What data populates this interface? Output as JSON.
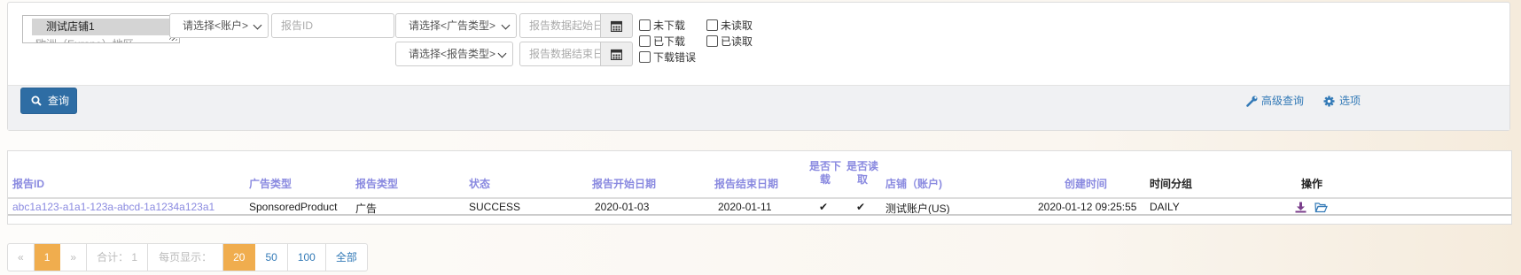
{
  "filters": {
    "store_select": {
      "selected": "测试店铺1",
      "second_option": "欧洲（Europe）地区"
    },
    "account_select": "请选择<账户>",
    "report_id_placeholder": "报告ID",
    "ad_type_select": "请选择<广告类型>",
    "report_type_select": "请选择<报告类型>",
    "start_date_placeholder": "报告数据起始日期",
    "end_date_placeholder": "报告数据结束日期",
    "checkboxes": {
      "not_downloaded": "未下载",
      "downloaded": "已下载",
      "download_error": "下载错误",
      "unread": "未读取",
      "read": "已读取"
    },
    "query_button": "查询",
    "advanced_query": "高级查询",
    "options": "选项"
  },
  "table": {
    "headers": {
      "report_id": "报告ID",
      "ad_type": "广告类型",
      "report_type": "报告类型",
      "status": "状态",
      "start_date": "报告开始日期",
      "end_date": "报告结束日期",
      "is_downloaded_1": "是否下",
      "is_downloaded_2": "载",
      "is_read_1": "是否读",
      "is_read_2": "取",
      "store_account": "店铺（账户)",
      "created_time": "创建时间",
      "time_group": "时间分组",
      "actions": "操作"
    },
    "rows": [
      {
        "report_id": "abc1a123-a1a1-123a-abcd-1a1234a123a1",
        "ad_type": "SponsoredProduct",
        "report_type": "广告",
        "status": "SUCCESS",
        "start_date": "2020-01-03",
        "end_date": "2020-01-11",
        "is_downloaded": "✔",
        "is_read": "✔",
        "store_account": "测试账户(US)",
        "created_time": "2020-01-12 09:25:55",
        "time_group": "DAILY"
      }
    ]
  },
  "pagination": {
    "prev": "«",
    "current_page": "1",
    "next": "»",
    "total": "合计： 1",
    "per_page_label": "每页显示：",
    "sizes": [
      "20",
      "50",
      "100",
      "全部"
    ]
  },
  "colors": {
    "primary": "#2e6da4",
    "link": "#337ab7",
    "header_text": "#8a8ae0",
    "pager_active": "#f0ad4e",
    "download_icon": "#7b3f8c",
    "folder_icon": "#337ab7"
  }
}
